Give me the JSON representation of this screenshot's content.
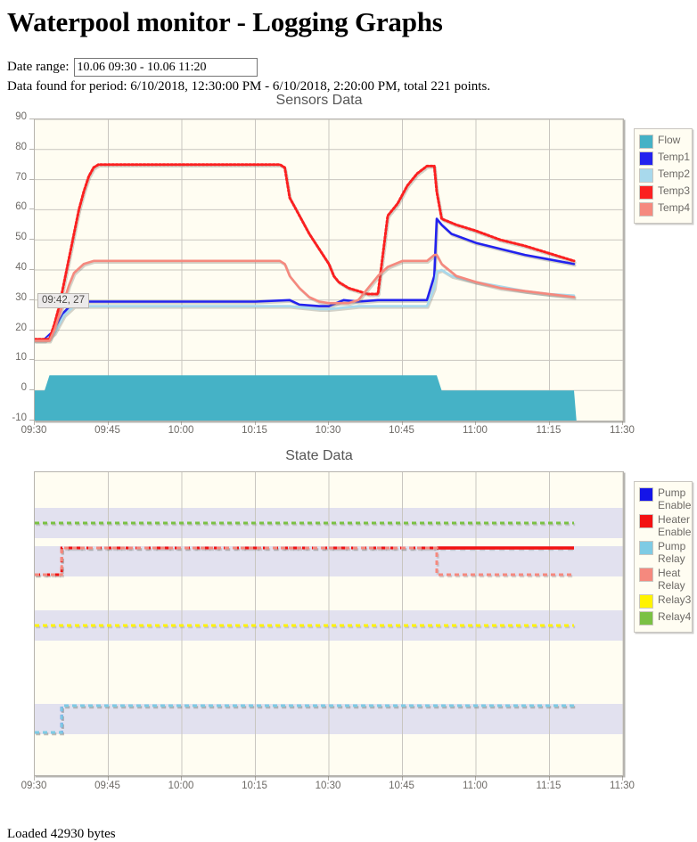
{
  "page": {
    "title": "Waterpool monitor - Logging Graphs",
    "footer": "Loaded 42930 bytes"
  },
  "controls": {
    "date_label": "Date range:",
    "date_value": "10.06 09:30 - 10.06 11:20",
    "date_placeholder": "10.06 09:30 - 10.06 11:20",
    "status": "Data found for period: 6/10/2018, 12:30:00 PM - 6/10/2018, 2:20:00 PM, total 221 points."
  },
  "tooltip": {
    "text": "09:42, 27"
  },
  "colors": {
    "flow": "#45b2c6",
    "temp1": "#2222ee",
    "temp2": "#a8d9ec",
    "temp3": "#fb2020",
    "temp4": "#f5897e",
    "pump_enable": "#1414e8",
    "heater_enable": "#f31111",
    "pump_relay": "#7ecbe4",
    "heat_relay": "#f5897e",
    "relay3": "#fff300",
    "relay4": "#7ac143",
    "plot_bg": "#fffdf2",
    "grid": "#c9c6c0",
    "band": "#e2e1ef",
    "axis_text": "#6d6a66"
  },
  "chart_data": [
    {
      "type": "line",
      "title": "Sensors Data",
      "xlabel": "",
      "ylabel": "",
      "xlim": [
        570,
        690
      ],
      "ylim": [
        -10,
        90
      ],
      "grid": true,
      "legend_position": "right",
      "xticks": [
        "09:30",
        "09:45",
        "10:00",
        "10:15",
        "10:30",
        "10:45",
        "11:00",
        "11:15",
        "11:30"
      ],
      "xtick_values": [
        570,
        585,
        600,
        615,
        630,
        645,
        660,
        675,
        690
      ],
      "yticks": [
        -10,
        0,
        10,
        20,
        30,
        40,
        50,
        60,
        70,
        80,
        90
      ],
      "series": [
        {
          "name": "Flow",
          "color": "#45b2c6",
          "style": "area",
          "x": [
            570,
            572,
            573,
            652,
            653,
            680,
            680.5
          ],
          "values": [
            0,
            0,
            5,
            5,
            0,
            0,
            -10
          ]
        },
        {
          "name": "Temp1",
          "color": "#2222ee",
          "style": "line",
          "x": [
            570,
            572,
            574,
            576,
            578,
            600,
            615,
            622,
            624,
            628,
            630,
            633,
            636,
            640,
            645,
            650,
            651.5,
            652,
            653,
            655,
            660,
            665,
            670,
            675,
            680
          ],
          "values": [
            17,
            17,
            20,
            26,
            29.5,
            29.5,
            29.5,
            30,
            28.5,
            28,
            28,
            30,
            29.5,
            30,
            30,
            30,
            38,
            57,
            55,
            52,
            49,
            47,
            45,
            43.5,
            42
          ]
        },
        {
          "name": "Temp2",
          "color": "#a8d9ec",
          "style": "line",
          "x": [
            570,
            572,
            574,
            576,
            578,
            600,
            615,
            622,
            628,
            630,
            636,
            640,
            645,
            650,
            651.5,
            652,
            653,
            655,
            660,
            665,
            670,
            675,
            680
          ],
          "values": [
            16.5,
            16.5,
            19,
            25,
            28,
            28,
            28,
            28,
            27,
            27,
            28,
            28,
            28,
            28,
            34,
            39.5,
            40,
            38,
            36,
            34.5,
            33,
            32,
            31.5
          ]
        },
        {
          "name": "Temp3",
          "color": "#fb2020",
          "style": "dotted",
          "x": [
            570,
            573,
            574,
            575,
            576,
            577,
            578,
            579,
            580,
            581,
            582,
            583,
            600,
            615,
            620,
            621,
            622,
            624,
            626,
            628,
            630,
            631,
            632,
            634,
            636,
            638,
            640,
            642,
            644,
            646,
            648,
            650,
            651,
            651.5,
            652,
            653,
            656,
            660,
            665,
            670,
            675,
            680
          ],
          "values": [
            17,
            17,
            22,
            28,
            36,
            44,
            52,
            60,
            66,
            71,
            74,
            75,
            75,
            75,
            75,
            74,
            64,
            58,
            52,
            47,
            42,
            38,
            36,
            34,
            33,
            32,
            32,
            58,
            62,
            68,
            72,
            74.5,
            74.5,
            74.5,
            66,
            57,
            55,
            53,
            50,
            48,
            45.5,
            43
          ]
        },
        {
          "name": "Temp4",
          "color": "#f5897e",
          "style": "line",
          "x": [
            570,
            573,
            574,
            575,
            576,
            577,
            578,
            580,
            582,
            600,
            615,
            620,
            621,
            622,
            624,
            626,
            628,
            630,
            632,
            634,
            636,
            638,
            640,
            642,
            645,
            650,
            651.5,
            652,
            653,
            656,
            660,
            665,
            670,
            675,
            680
          ],
          "values": [
            16.5,
            16.5,
            20,
            25,
            30,
            35,
            39,
            42,
            43,
            43,
            43,
            43,
            42,
            38,
            34,
            31,
            29.5,
            29,
            29,
            29,
            30,
            34,
            38,
            41,
            43,
            43,
            45,
            45,
            42,
            38,
            36,
            34,
            33,
            32,
            31
          ]
        }
      ]
    },
    {
      "type": "line",
      "title": "State Data",
      "xlabel": "",
      "ylabel": "",
      "xlim": [
        570,
        690
      ],
      "ylim": [
        0,
        1
      ],
      "grid": true,
      "legend_position": "right",
      "xticks": [
        "09:30",
        "09:45",
        "10:00",
        "10:15",
        "10:30",
        "10:45",
        "11:00",
        "11:15",
        "11:30"
      ],
      "xtick_values": [
        570,
        585,
        600,
        615,
        630,
        645,
        660,
        675,
        690
      ],
      "yticks": [],
      "series": [
        {
          "name": "Pump Enable",
          "color": "#1414e8",
          "style": "dashed",
          "lane": 0,
          "x": [
            570,
            575,
            575.5,
            680
          ],
          "values": [
            0,
            0,
            1,
            1
          ]
        },
        {
          "name": "Heater Enable",
          "color": "#f31111",
          "style": "dashed-then-solid",
          "lane": 1,
          "x": [
            570,
            575,
            575.5,
            652,
            680
          ],
          "values": [
            0,
            0,
            1,
            1,
            1
          ]
        },
        {
          "name": "Pump Relay",
          "color": "#7ecbe4",
          "style": "dashed",
          "lane": 0,
          "x": [
            570,
            575,
            575.5,
            680
          ],
          "values": [
            0,
            0,
            1,
            1
          ]
        },
        {
          "name": "Heat Relay",
          "color": "#f5897e",
          "style": "dashed",
          "lane": 1,
          "x": [
            570,
            575,
            575.5,
            651,
            652,
            680
          ],
          "values": [
            0,
            0,
            1,
            1,
            0,
            0
          ]
        },
        {
          "name": "Relay3",
          "color": "#fff300",
          "style": "dashed",
          "lane": 2,
          "x": [
            570,
            680
          ],
          "values": [
            1,
            1
          ]
        },
        {
          "name": "Relay4",
          "color": "#7ac143",
          "style": "dashed",
          "lane": 3,
          "x": [
            570,
            680
          ],
          "values": [
            1,
            1
          ]
        }
      ]
    }
  ]
}
